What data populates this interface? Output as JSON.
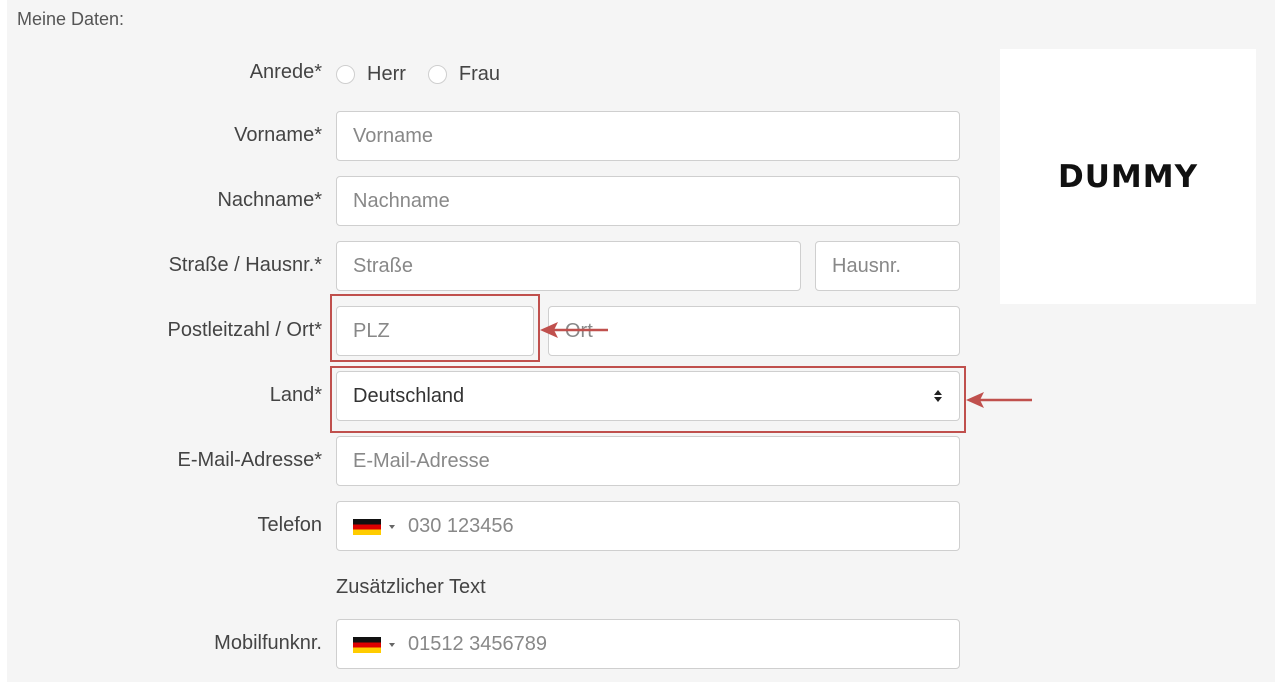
{
  "section": {
    "title": "Meine Daten:"
  },
  "form": {
    "salutation": {
      "label": "Anrede*",
      "options": [
        "Herr",
        "Frau"
      ]
    },
    "first_name": {
      "label": "Vorname*",
      "placeholder": "Vorname"
    },
    "last_name": {
      "label": "Nachname*",
      "placeholder": "Nachname"
    },
    "street": {
      "label": "Straße / Hausnr.*",
      "street_placeholder": "Straße",
      "number_placeholder": "Hausnr."
    },
    "city": {
      "label": "Postleitzahl / Ort*",
      "zip_placeholder": "PLZ",
      "city_placeholder": "Ort"
    },
    "country": {
      "label": "Land*",
      "value": "Deutschland"
    },
    "email": {
      "label": "E-Mail-Adresse*",
      "placeholder": "E-Mail-Adresse"
    },
    "phone": {
      "label": "Telefon",
      "placeholder": "030 123456",
      "flag": "de-flag"
    },
    "extra_text": "Zusätzlicher Text",
    "mobile": {
      "label": "Mobilfunknr.",
      "placeholder": "01512 3456789",
      "flag": "de-flag"
    }
  },
  "logo": {
    "text": "DUMMY"
  },
  "annotation": {
    "color": "#c0504d"
  }
}
